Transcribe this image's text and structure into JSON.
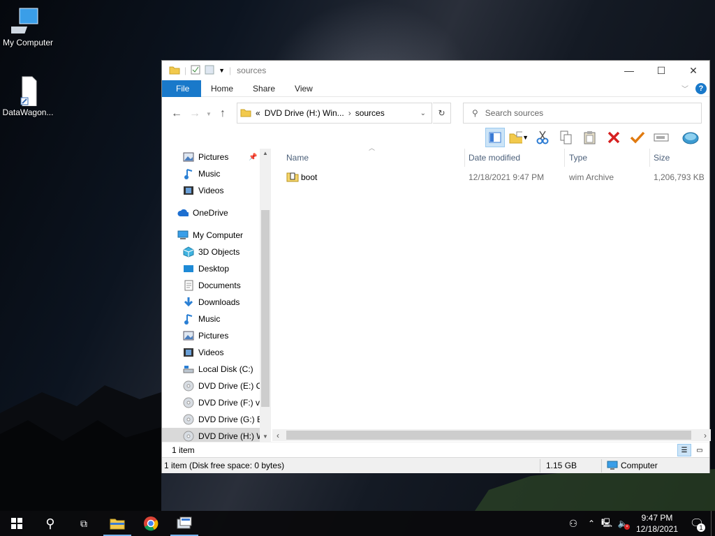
{
  "desktop": {
    "icons": [
      {
        "label": "My Computer",
        "icon": "monitor-icon"
      },
      {
        "label": "DataWagon...",
        "icon": "file-shortcut-icon"
      }
    ]
  },
  "window": {
    "title": "sources",
    "tabs": {
      "file": "File",
      "home": "Home",
      "share": "Share",
      "view": "View"
    },
    "address": {
      "prefix": "«",
      "crumb1": "DVD Drive (H:) Win...",
      "crumb2": "sources"
    },
    "search": {
      "placeholder": "Search sources"
    },
    "nav": [
      {
        "label": "Pictures",
        "icon": "pictures-icon"
      },
      {
        "label": "Music",
        "icon": "music-icon"
      },
      {
        "label": "Videos",
        "icon": "videos-icon"
      },
      {
        "label": "OneDrive",
        "icon": "onedrive-icon"
      },
      {
        "label": "My Computer",
        "icon": "computer-icon"
      },
      {
        "label": "3D Objects",
        "icon": "3d-objects-icon"
      },
      {
        "label": "Desktop",
        "icon": "desktop-icon"
      },
      {
        "label": "Documents",
        "icon": "documents-icon"
      },
      {
        "label": "Downloads",
        "icon": "downloads-icon"
      },
      {
        "label": "Music",
        "icon": "music-icon"
      },
      {
        "label": "Pictures",
        "icon": "pictures-icon"
      },
      {
        "label": "Videos",
        "icon": "videos-icon"
      },
      {
        "label": "Local Disk (C:)",
        "icon": "disk-icon"
      },
      {
        "label": "DVD Drive (E:) CC",
        "icon": "dvd-icon"
      },
      {
        "label": "DVD Drive (F:) vi",
        "icon": "dvd-icon"
      },
      {
        "label": "DVD Drive (G:) Ea",
        "icon": "dvd-icon"
      },
      {
        "label": "DVD Drive (H:) W",
        "icon": "dvd-icon"
      }
    ],
    "columns": {
      "name": "Name",
      "date": "Date modified",
      "type": "Type",
      "size": "Size"
    },
    "files": [
      {
        "name": "boot",
        "date": "12/18/2021 9:47 PM",
        "type": "wim Archive",
        "size": "1,206,793 KB"
      }
    ],
    "item_count": "1 item",
    "status": {
      "left": "1 item (Disk free space: 0 bytes)",
      "size": "1.15 GB",
      "location": "Computer"
    }
  },
  "taskbar": {
    "clock_time": "9:47 PM",
    "clock_date": "12/18/2021",
    "notification_count": "1"
  },
  "colors": {
    "accent": "#1979ca",
    "taskbar": "#0a0a0c"
  }
}
